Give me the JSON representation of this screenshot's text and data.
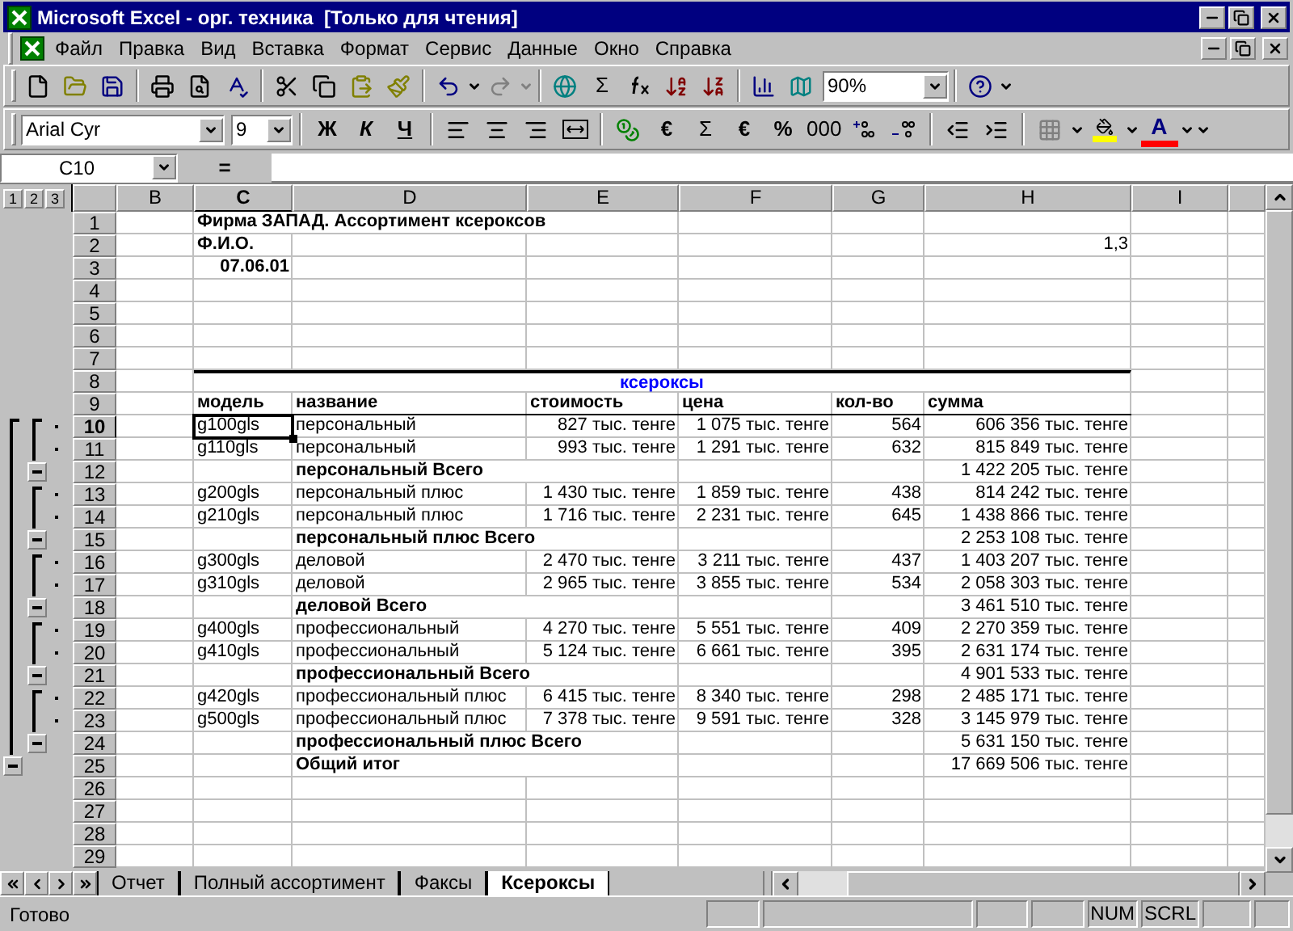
{
  "window": {
    "title": "Microsoft Excel - орг. техника  [Только для чтения]"
  },
  "menu": [
    "Файл",
    "Правка",
    "Вид",
    "Вставка",
    "Формат",
    "Сервис",
    "Данные",
    "Окно",
    "Справка"
  ],
  "standard_toolbar": {
    "sum": "Σ",
    "zoom": "90%",
    "redo": {
      "disabled": true
    }
  },
  "formatting_toolbar": {
    "font": "Arial Cyr",
    "size": "9",
    "bold": "Ж",
    "italic": "К",
    "underline": "Ч",
    "euro": "€",
    "sum": "Σ",
    "euro_2": "€",
    "percent": "%",
    "thousands": "000",
    "font_color": "A"
  },
  "formula_bar": {
    "name_box": "C10",
    "equals": "="
  },
  "outline_levels": [
    "1",
    "2",
    "3"
  ],
  "columns": [
    {
      "label": "B",
      "selected": false
    },
    {
      "label": "C",
      "selected": true
    },
    {
      "label": "D",
      "selected": false
    },
    {
      "label": "E",
      "selected": false
    },
    {
      "label": "F",
      "selected": false
    },
    {
      "label": "G",
      "selected": false
    },
    {
      "label": "H",
      "selected": false
    },
    {
      "label": "I",
      "selected": false
    }
  ],
  "rows": [
    {
      "header": "1",
      "kind": "title",
      "selected": false,
      "text": "Фирма ЗАПАД. Ассортимент ксероксов"
    },
    {
      "header": "2",
      "kind": "title",
      "selected": false,
      "text": "Ф.И.О.",
      "value": "1,3"
    },
    {
      "header": "3",
      "kind": "date",
      "selected": false,
      "text": "07.06.01"
    },
    {
      "header": "4",
      "kind": "blank",
      "selected": false
    },
    {
      "header": "5",
      "kind": "blank",
      "selected": false
    },
    {
      "header": "6",
      "kind": "blank",
      "selected": false
    },
    {
      "header": "7",
      "kind": "blank",
      "selected": false
    },
    {
      "header": "8",
      "kind": "caption",
      "selected": false,
      "caption": "ксероксы"
    },
    {
      "header": "9",
      "kind": "header",
      "selected": false,
      "model": "модель",
      "name": "название",
      "cost": "стоимость",
      "price": "цена",
      "qty": "кол-во",
      "sum": "сумма"
    },
    {
      "header": "10",
      "kind": "data",
      "selected": true,
      "model": "g100gls",
      "name": "персональный",
      "cost": "827 тыс. тенге",
      "price": "1 075 тыс. тенге",
      "qty": "564",
      "sum": "606 356 тыс. тенге"
    },
    {
      "header": "11",
      "kind": "data",
      "selected": false,
      "model": "g110gls",
      "name": "персональный",
      "cost": "993 тыс. тенге",
      "price": "1 291 тыс. тенге",
      "qty": "632",
      "sum": "815 849 тыс. тенге"
    },
    {
      "header": "12",
      "kind": "total",
      "selected": false,
      "expanded": true,
      "name": "персональный Всего",
      "sum": "1 422 205 тыс. тенге"
    },
    {
      "header": "13",
      "kind": "data",
      "selected": false,
      "model": "g200gls",
      "name": "персональный плюс",
      "cost": "1 430 тыс. тенге",
      "price": "1 859 тыс. тенге",
      "qty": "438",
      "sum": "814 242 тыс. тенге"
    },
    {
      "header": "14",
      "kind": "data",
      "selected": false,
      "model": "g210gls",
      "name": "персональный плюс",
      "cost": "1 716 тыс. тенге",
      "price": "2 231 тыс. тенге",
      "qty": "645",
      "sum": "1 438 866 тыс. тенге"
    },
    {
      "header": "15",
      "kind": "total",
      "selected": false,
      "expanded": true,
      "name": "персональный плюс Всего",
      "sum": "2 253 108 тыс. тенге"
    },
    {
      "header": "16",
      "kind": "data",
      "selected": false,
      "model": "g300gls",
      "name": "деловой",
      "cost": "2 470 тыс. тенге",
      "price": "3 211 тыс. тенге",
      "qty": "437",
      "sum": "1 403 207 тыс. тенге"
    },
    {
      "header": "17",
      "kind": "data",
      "selected": false,
      "model": "g310gls",
      "name": "деловой",
      "cost": "2 965 тыс. тенге",
      "price": "3 855 тыс. тенге",
      "qty": "534",
      "sum": "2 058 303 тыс. тенге"
    },
    {
      "header": "18",
      "kind": "total",
      "selected": false,
      "expanded": true,
      "name": "деловой Всего",
      "sum": "3 461 510 тыс. тенге"
    },
    {
      "header": "19",
      "kind": "data",
      "selected": false,
      "model": "g400gls",
      "name": "профессиональный",
      "cost": "4 270 тыс. тенге",
      "price": "5 551 тыс. тенге",
      "qty": "409",
      "sum": "2 270 359 тыс. тенге"
    },
    {
      "header": "20",
      "kind": "data",
      "selected": false,
      "model": "g410gls",
      "name": "профессиональный",
      "cost": "5 124 тыс. тенге",
      "price": "6 661 тыс. тенге",
      "qty": "395",
      "sum": "2 631 174 тыс. тенге"
    },
    {
      "header": "21",
      "kind": "total",
      "selected": false,
      "expanded": true,
      "name": "профессиональный Всего",
      "sum": "4 901 533 тыс. тенге"
    },
    {
      "header": "22",
      "kind": "data",
      "selected": false,
      "model": "g420gls",
      "name": "профессиональный плюс",
      "cost": "6 415 тыс. тенге",
      "price": "8 340 тыс. тенге",
      "qty": "298",
      "sum": "2 485 171 тыс. тенге"
    },
    {
      "header": "23",
      "kind": "data",
      "selected": false,
      "model": "g500gls",
      "name": "профессиональный плюс",
      "cost": "7 378 тыс. тенге",
      "price": "9 591 тыс. тенге",
      "qty": "328",
      "sum": "3 145 979 тыс. тенге"
    },
    {
      "header": "24",
      "kind": "total",
      "selected": false,
      "expanded": true,
      "name": "профессиональный плюс Всего",
      "sum": "5 631 150 тыс. тенге"
    },
    {
      "header": "25",
      "kind": "grand_total",
      "selected": false,
      "expanded": true,
      "name": "Общий итог",
      "sum": "17 669 506 тыс. тенге"
    },
    {
      "header": "26",
      "kind": "blank",
      "selected": false
    },
    {
      "header": "27",
      "kind": "blank",
      "selected": false
    },
    {
      "header": "28",
      "kind": "blank",
      "selected": false
    },
    {
      "header": "29",
      "kind": "blank",
      "selected": false
    }
  ],
  "sheet_tabs": [
    {
      "label": "Отчет",
      "selected": false
    },
    {
      "label": "Полный ассортимент",
      "selected": false
    },
    {
      "label": "Факсы",
      "selected": false
    },
    {
      "label": "Ксероксы",
      "selected": true
    }
  ],
  "status_bar": {
    "message": "Готово",
    "indicators": [
      "NUM",
      "SCRL"
    ]
  }
}
